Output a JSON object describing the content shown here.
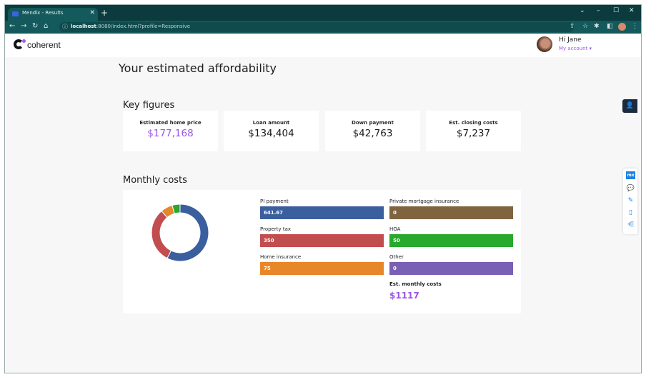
{
  "browser": {
    "tab_title": "Mendix - Results",
    "url_host": "localhost",
    "url_rest": ":8080/index.html?profile=Responsive"
  },
  "header": {
    "logo_text": "coherent",
    "greeting": "Hi Jane",
    "account_link": "My account ▾"
  },
  "page": {
    "title": "Your estimated affordability",
    "key_figures_heading": "Key figures",
    "monthly_costs_heading": "Monthly costs"
  },
  "key_figures": [
    {
      "label": "Estimated home price",
      "value": "$177,168",
      "accent": true
    },
    {
      "label": "Loan amount",
      "value": "$134,404",
      "accent": false
    },
    {
      "label": "Down payment",
      "value": "$42,763",
      "accent": false
    },
    {
      "label": "Est. closing costs",
      "value": "$7,237",
      "accent": false
    }
  ],
  "monthly_costs": {
    "items": [
      {
        "label": "PI payment",
        "value": "641.67",
        "color": "#3b5e9e"
      },
      {
        "label": "Property tax",
        "value": "350",
        "color": "#c24d4f"
      },
      {
        "label": "Home insurance",
        "value": "75",
        "color": "#e8862a"
      },
      {
        "label": "Private mortgage insurance",
        "value": "0",
        "color": "#80643f"
      },
      {
        "label": "HOA",
        "value": "50",
        "color": "#28a82c"
      },
      {
        "label": "Other",
        "value": "0",
        "color": "#7a60b4"
      }
    ],
    "total_label": "Est. monthly costs",
    "total_value": "$1117"
  },
  "chart_data": {
    "type": "pie",
    "title": "",
    "donut": true,
    "categories": [
      "PI payment",
      "Property tax",
      "Home insurance",
      "Private mortgage insurance",
      "HOA",
      "Other"
    ],
    "values": [
      641.67,
      350,
      75,
      0,
      50,
      0
    ],
    "colors": [
      "#3b5e9e",
      "#c24d4f",
      "#e8862a",
      "#80643f",
      "#28a82c",
      "#7a60b4"
    ]
  },
  "dev_toolbar": {
    "mx_label": "mx"
  }
}
